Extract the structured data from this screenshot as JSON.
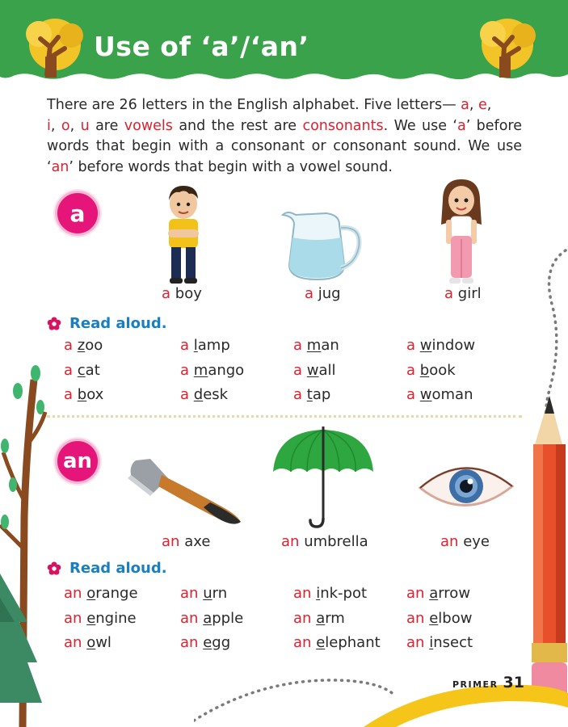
{
  "title": "Use of ‘a’/‘an’",
  "intro": {
    "p1": "There are 26 letters in the English alphabet. Five letters— ",
    "v1": "a",
    "c1": ", ",
    "v2": "e",
    "c2": ",",
    "v3": "i",
    "c3": ", ",
    "v4": "o",
    "c4": ", ",
    "v5": "u",
    "p2": " are ",
    "vowels": "vowels",
    "p3": " and the rest are ",
    "consonants": "consonants",
    "p4": ". We use ‘",
    "a": "a",
    "p5": "’ before words that begin with a consonant or consonant sound. We use ‘",
    "an": "an",
    "p6": "’ before words that begin with a vowel sound."
  },
  "section_a": {
    "badge": "a",
    "pictures": [
      {
        "article": "a",
        "noun": "boy",
        "icon": "boy-illustration"
      },
      {
        "article": "a",
        "noun": "jug",
        "icon": "jug-illustration"
      },
      {
        "article": "a",
        "noun": "girl",
        "icon": "girl-illustration"
      }
    ],
    "read_aloud": "Read aloud.",
    "words": [
      {
        "article": "a",
        "first": "z",
        "rest": "oo"
      },
      {
        "article": "a",
        "first": "l",
        "rest": "amp"
      },
      {
        "article": "a",
        "first": "m",
        "rest": "an"
      },
      {
        "article": "a",
        "first": "w",
        "rest": "indow"
      },
      {
        "article": "a",
        "first": "c",
        "rest": "at"
      },
      {
        "article": "a",
        "first": "m",
        "rest": "ango"
      },
      {
        "article": "a",
        "first": "w",
        "rest": "all"
      },
      {
        "article": "a",
        "first": "b",
        "rest": "ook"
      },
      {
        "article": "a",
        "first": "b",
        "rest": "ox"
      },
      {
        "article": "a",
        "first": "d",
        "rest": "esk"
      },
      {
        "article": "a",
        "first": "t",
        "rest": "ap"
      },
      {
        "article": "a",
        "first": "w",
        "rest": "oman"
      }
    ]
  },
  "section_an": {
    "badge": "an",
    "pictures": [
      {
        "article": "an",
        "noun": "axe",
        "icon": "axe-illustration"
      },
      {
        "article": "an",
        "noun": "umbrella",
        "icon": "umbrella-illustration"
      },
      {
        "article": "an",
        "noun": "eye",
        "icon": "eye-illustration"
      }
    ],
    "read_aloud": "Read aloud.",
    "words": [
      {
        "article": "an",
        "first": "o",
        "rest": "range"
      },
      {
        "article": "an",
        "first": "u",
        "rest": "rn"
      },
      {
        "article": "an",
        "first": "i",
        "rest": "nk-pot"
      },
      {
        "article": "an",
        "first": "a",
        "rest": "rrow"
      },
      {
        "article": "an",
        "first": "e",
        "rest": "ngine"
      },
      {
        "article": "an",
        "first": "a",
        "rest": "pple"
      },
      {
        "article": "an",
        "first": "a",
        "rest": "rm"
      },
      {
        "article": "an",
        "first": "e",
        "rest": "lbow"
      },
      {
        "article": "an",
        "first": "o",
        "rest": "wl"
      },
      {
        "article": "an",
        "first": "e",
        "rest": "gg"
      },
      {
        "article": "an",
        "first": "e",
        "rest": "lephant"
      },
      {
        "article": "an",
        "first": "i",
        "rest": "nsect"
      }
    ]
  },
  "footer": {
    "book": "PRIMER",
    "page": "31"
  },
  "colors": {
    "header_green": "#3aa24a",
    "article_red": "#e0202e",
    "badge_pink": "#e6157a",
    "heading_blue": "#1a7fc1"
  }
}
